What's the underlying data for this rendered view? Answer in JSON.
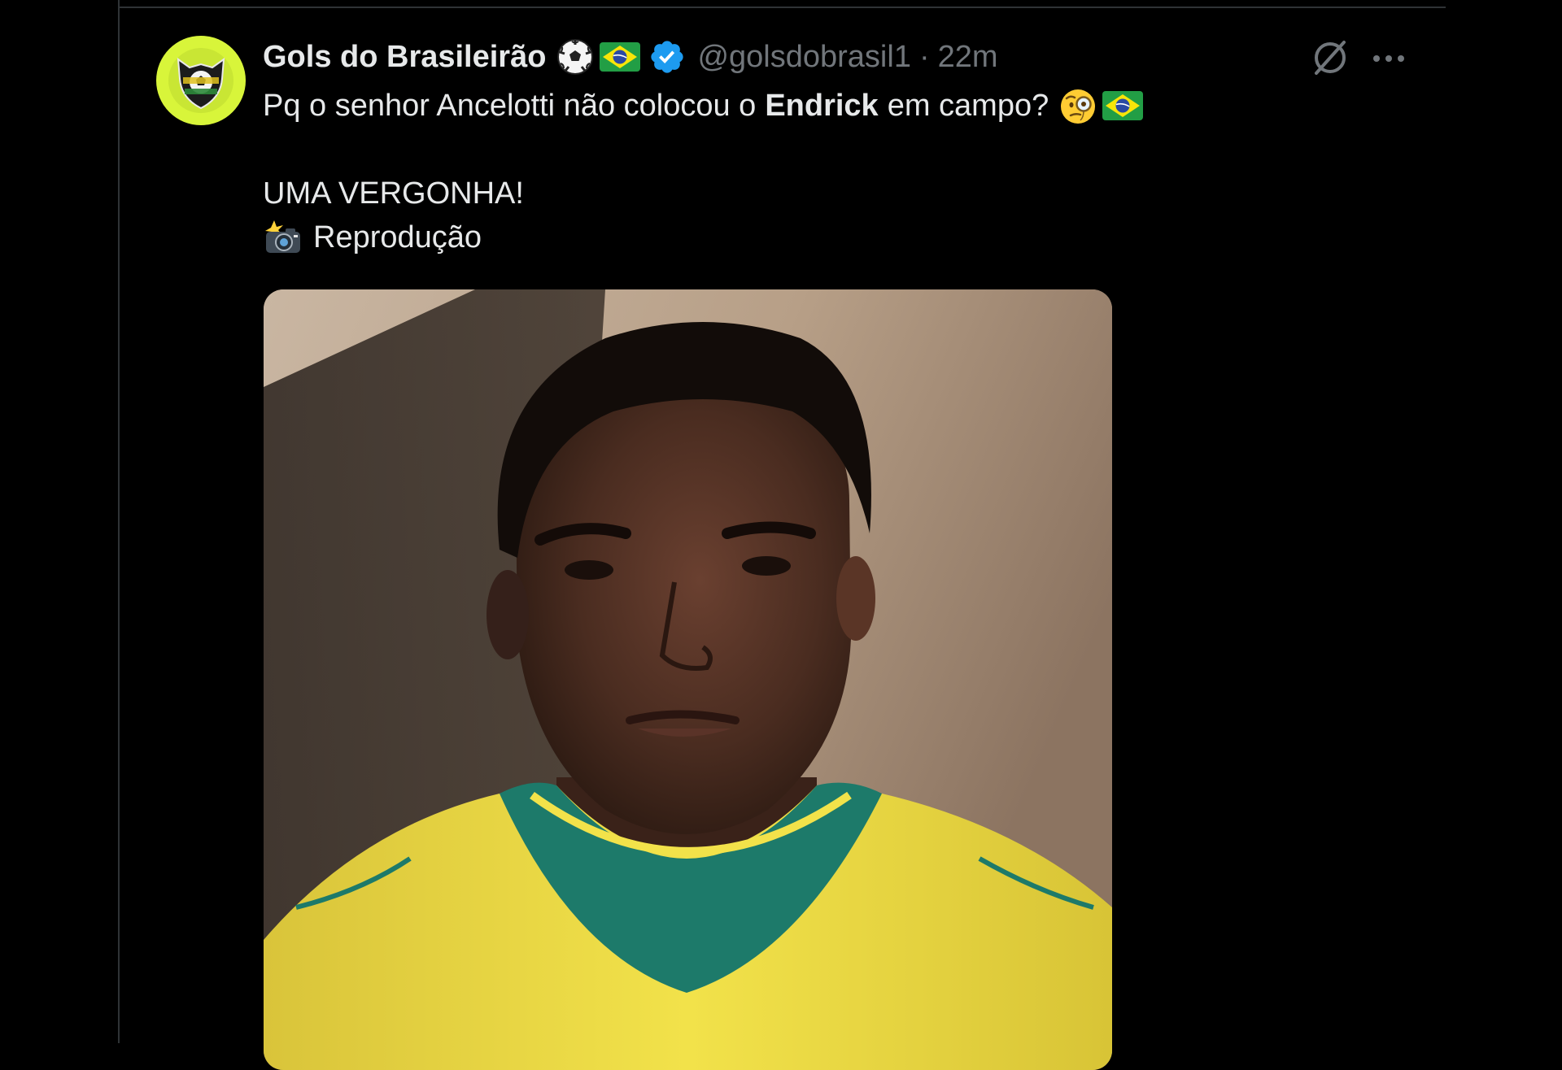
{
  "tweet": {
    "display_name": "Gols do Brasileirão",
    "handle": "@golsdobrasil1",
    "separator": "·",
    "time": "22m",
    "name_emojis": [
      "soccer-ball-icon",
      "brazil-flag-icon"
    ],
    "verified": true,
    "text": {
      "line1_before": "Pq o senhor Ancelotti não colocou o",
      "line1_bold": "Endrick",
      "line1_after": "em campo?",
      "line1_emojis": [
        "face-with-monocle-icon",
        "brazil-flag-icon"
      ],
      "line2": "UMA VERGONHA!",
      "line3_emoji": "camera-flash-icon",
      "line3": "Reprodução"
    },
    "media": {
      "type": "photo",
      "subject": "portrait-in-yellow-jersey"
    }
  },
  "colors": {
    "background": "#000000",
    "text_primary": "#e7e9ea",
    "text_secondary": "#71767b",
    "divider": "#2f3336",
    "verified_blue": "#1d9bf0",
    "avatar_bg": "#d8f53a",
    "jersey_yellow": "#f2e24a",
    "collar_green": "#1d7a6a"
  },
  "icons": {
    "grok": "grok-icon",
    "more": "more-options-icon"
  }
}
